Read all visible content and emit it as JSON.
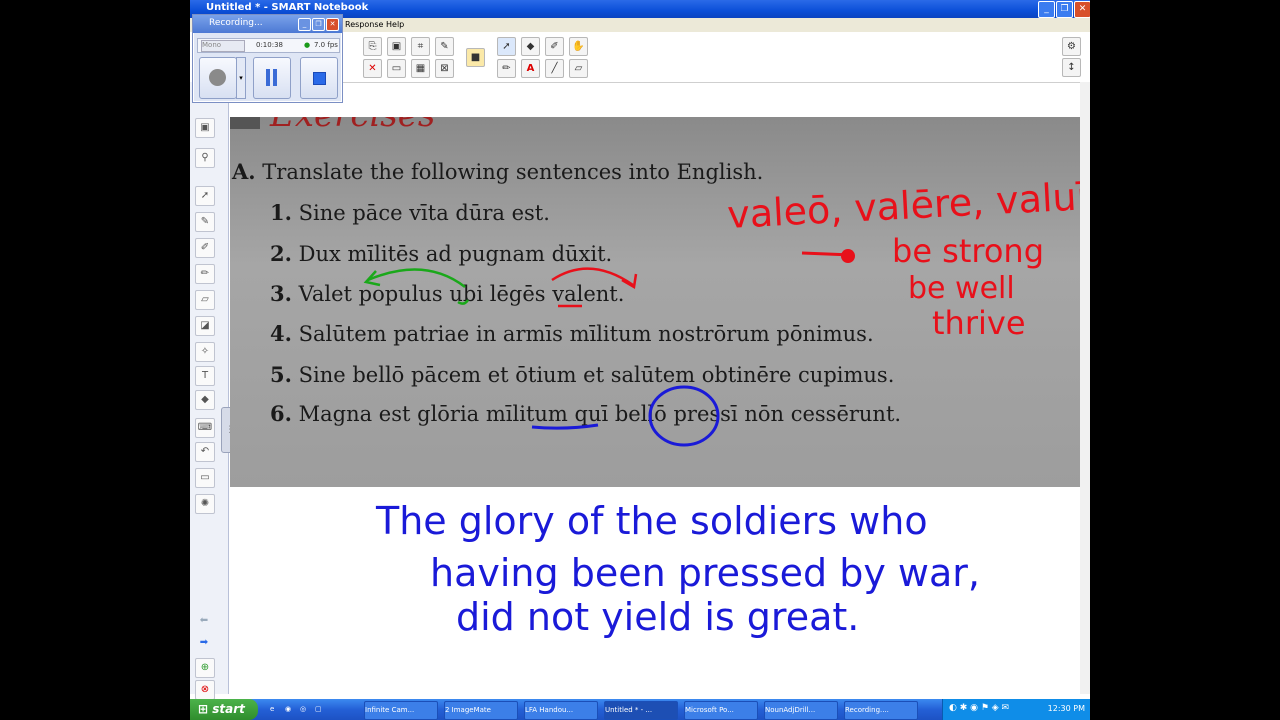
{
  "window": {
    "title": "Untitled * - SMART Notebook",
    "min_label": "_",
    "max_label": "❐",
    "close_label": "✕"
  },
  "menu": {
    "items": [
      "Response",
      "Help"
    ]
  },
  "toolbar": {
    "right_top_icon": "gear-icon",
    "right_bottom_icon": "arrows-icon",
    "right_top_glyph": "⚙",
    "right_bottom_glyph": "↕"
  },
  "recorder": {
    "title": "Recording...",
    "mode": "Mono",
    "time": "0:10:38",
    "fps": "7.0 fps"
  },
  "page": {
    "heading": "Exercises",
    "instruction": "Translate the following sentences into English.",
    "instruction_label": "A.",
    "sentences": [
      {
        "num": "1.",
        "text": "Sine pāce vīta dūra est."
      },
      {
        "num": "2.",
        "text": "Dux mīlitēs ad pugnam dūxit."
      },
      {
        "num": "3.",
        "text": "Valet populus ubi lēgēs valent."
      },
      {
        "num": "4.",
        "text": "Salūtem patriae in armīs mīlitum nostrōrum pōnimus."
      },
      {
        "num": "5.",
        "text": "Sine bellō pācem et ōtium et salūtem obtinēre cupimus."
      },
      {
        "num": "6.",
        "text": "Magna est glōria mīlitum quī bellō pressī nōn cessērunt."
      }
    ]
  },
  "handwriting": {
    "red_line1": "valeō, valēre, valuī",
    "red_line2": "be strong",
    "red_line3": "be well",
    "red_line4": "thrive",
    "blue_line1": "The glory of the soldiers who",
    "blue_line2": "having been pressed by war,",
    "blue_line3": "did not yield  is great."
  },
  "taskbar": {
    "start": "start",
    "tasks": [
      "Infinite Cam...",
      "2 ImageMate",
      "LFA Handou...",
      "Untitled * - ...",
      "Microsoft Po...",
      "NounAdjDrill...",
      "Recording...."
    ],
    "clock": "12:30 PM"
  },
  "colors": {
    "ink_red": "#e8101a",
    "ink_blue": "#1a1ad8",
    "ink_green": "#1aa81a",
    "xp_blue": "#0b4fd8"
  }
}
